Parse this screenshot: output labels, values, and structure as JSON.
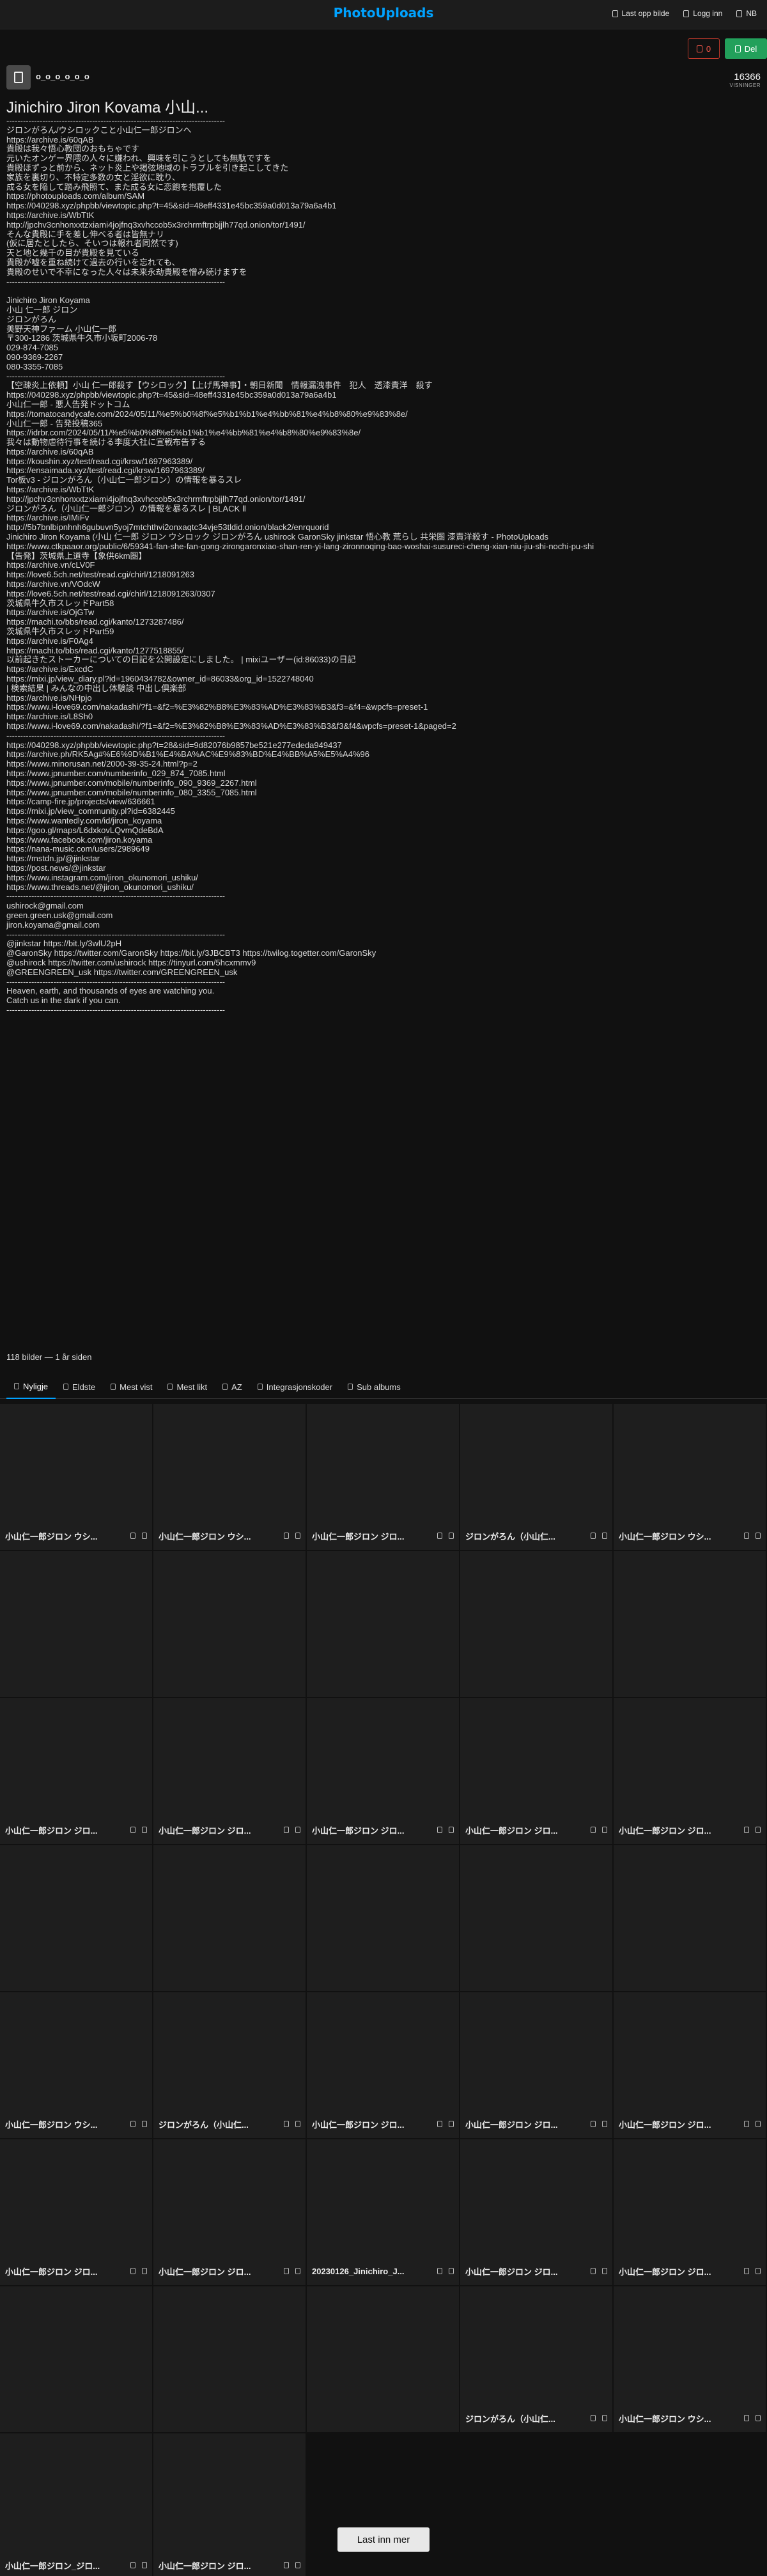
{
  "app": {
    "logo": "PhotoUploads"
  },
  "nav": {
    "upload": "Last opp bilde",
    "login": "Logg inn",
    "lang": "NB"
  },
  "header": {
    "username": "o_o_o_o_o_o",
    "counter": "0",
    "share": "Del",
    "views": "16366",
    "views_label": "VISNINGER"
  },
  "album": {
    "title": "Jinichiro Jiron Kovama 小山..."
  },
  "description": [
    "-------------------------------------------------------------------------------",
    "ジロンがろん/ウシロックこと小山仁一郎ジロンへ",
    "https://archive.is/60qAB",
    "貴殿は我々悟心教団のおもちゃです",
    "元いたオンゲー界隈の人々に嫌われ、興味を引こうとしても無駄ですを",
    "貴殿ほずっと前から、ネット炎上や掲弦地域のトラブルを引き起こしてきた",
    "家族を裏切り、不特定多数の女と淫欲に耽り、",
    "成る女を陥して踏み飛照て、また成る女に恋飽を抱覆した",
    "https://photouploads.com/album/SAM",
    "https://040298.xyz/phpbb/viewtopic.php?t=45&sid=48eff4331e45bc359a0d013a79a6a4b1",
    "https://archive.is/WbTtK",
    "http://jpchv3cnhonxxtzxiami4jojfnq3xvhccob5x3rchrmftrpbjjlh77qd.onion/tor/1491/",
    "そんな貴殿に手を差し伸べる者は皆無ナリ",
    "(仮に居たとしたら、そいつは報れ者同然です)",
    "天と地と幾千の目が貴殿を見ている",
    "貴殿が嘘を重ね続けて過去の行いを忘れても、",
    "貴殿のせいで不幸になった人々は未来永劫貴殿を憎み続けますを",
    "-------------------------------------------------------------------------------",
    "",
    "Jinichiro Jiron Koyama",
    "小山 仁一郎 ジロン",
    "ジロンがろん",
    "美野天神ファーム 小山仁一郎",
    "〒300-1286 茨城県牛久市小坂町2006-78",
    "029-874-7085",
    "090-9369-2267",
    "080-3355-7085",
    "-------------------------------------------------------------------------------",
    "【空疎炎上依頼】小山 仁一郎殺す【ウシロック】【上げ馬神事】・朝日新聞　情報漏洩事件　犯人　透漆責洋　殺す",
    "https://040298.xyz/phpbb/viewtopic.php?t=45&sid=48eff4331e45bc359a0d013a79a6a4b1",
    "小山仁一郎 - 悪人告発ドットコム",
    "https://tomatocandycafe.com/2024/05/11/%e5%b0%8f%e5%b1%b1%e4%bb%81%e4%b8%80%e9%83%8e/",
    "小山仁一郎 - 告発投稿365",
    "https://idrbr.com/2024/05/11/%e5%b0%8f%e5%b1%b1%e4%bb%81%e4%b8%80%e9%83%8e/",
    "我々は動物虐待行事を続ける李度大社に宣戦布告する",
    "https://archive.is/60qAB",
    "https://koushin.xyz/test/read.cgi/krsw/1697963389/",
    "https://ensaimada.xyz/test/read.cgi/krsw/1697963389/",
    "Tor板v3 - ジロンがろん（小山仁一郎ジロン）の情報を暴るスレ",
    "https://archive.is/WbTtK",
    "http://jpchv3cnhonxxtzxiami4jojfnq3xvhccob5x3rchrmftrpbjjlh77qd.onion/tor/1491/",
    "ジロンがろん（小山仁一郎ジロン）の情報を暴るスレ | BLACK Ⅱ",
    "https://archive.is/IMiFv",
    "http://5b7bnlbipnhnh6gubuvn5yoj7mtchthvi2onxaqtc34vje53tldid.onion/black2/enrquorid",
    "Jinichiro Jiron Koyama (小山 仁一郎 ジロン ウシロック ジロンがろん ushirock GaronSky jinkstar 悟心教 荒らし 共栄圏 漆責洋殺す - PhotoUploads",
    "https://www.ctkpaaor.org/public/6/59341-fan-she-fan-gong-zirongaronxiao-shan-ren-yi-lang-zironnoqing-bao-woshai-susureci-cheng-xian-niu-jiu-shi-nochi-pu-shi",
    "【告発】茨城県上道寺【象供6km圏】",
    "https://archive.vn/cLV0F",
    "https://love6.5ch.net/test/read.cgi/chirl/1218091263",
    "https://archive.vn/VOdcW",
    "https://love6.5ch.net/test/read.cgi/chirl/1218091263/0307",
    "茨城県牛久市スレッドPart58",
    "https://archive.is/OjGTw",
    "https://machi.to/bbs/read.cgi/kanto/1273287486/",
    "茨城県牛久市スレッドPart59",
    "https://archive.is/F0Ag4",
    "https://machi.to/bbs/read.cgi/kanto/1277518855/",
    "以前起きたストーカーについての日記を公開設定にしました。 | mixiユーザー(id:86033)の日記",
    "https://archive.is/ExcdC",
    "https://mixi.jp/view_diary.pl?id=1960434782&owner_id=86033&org_id=1522748040",
    "| 検索結果 | みんなの中出し体験談 中出し倶楽部",
    "https://archive.is/NHpjo",
    "https://www.i-love69.com/nakadashi/?f1=&f2=%E3%82%B8%E3%83%AD%E3%83%B3&f3=&f4=&wpcfs=preset-1",
    "https://archive.is/L8Sh0",
    "https://www.i-love69.com/nakadashi/?f1=&f2=%E3%82%B8%E3%83%AD%E3%83%B3&f3&f4&wpcfs=preset-1&paged=2",
    "-------------------------------------------------------------------------------",
    "https://040298.xyz/phpbb/viewtopic.php?t=28&sid=9d82076b9857be521e277ededa949437",
    "https://archive.ph/RK5Ag#%E6%9D%B1%E4%BA%AC%E9%83%BD%E4%BB%A5%E5%A4%96",
    "https://www.minorusan.net/2000-39-35-24.html?p=2",
    "https://www.jpnumber.com/numberinfo_029_874_7085.html",
    "https://www.jpnumber.com/mobile/numberinfo_090_9369_2267.html",
    "https://www.jpnumber.com/mobile/numberinfo_080_3355_7085.html",
    "https://camp-fire.jp/projects/view/636661",
    "https://mixi.jp/view_community.pl?id=6382445",
    "https://www.wantedly.com/id/jiron_koyama",
    "https://goo.gl/maps/L6dxkovLQvmQdeBdA",
    "https://www.facebook.com/jiron.koyama",
    "https://nana-music.com/users/2989649",
    "https://mstdn.jp/@jinkstar",
    "https://post.news/@jinkstar",
    "https://www.instagram.com/jiron_okunomori_ushiku/",
    "https://www.threads.net/@jiron_okunomori_ushiku/",
    "-------------------------------------------------------------------------------",
    "ushirock@gmail.com",
    "green.green.usk@gmail.com",
    "jiron.koyama@gmail.com",
    "-------------------------------------------------------------------------------",
    "@jinkstar https://bit.ly/3wlU2pH",
    "@GaronSky https://twitter.com/GaronSky https://bit.ly/3JBCBT3 https://twilog.togetter.com/GaronSky",
    "@ushirock https://twitter.com/ushirock https://tinyurl.com/5hcxmmv9",
    "@GREENGREEN_usk https://twitter.com/GREENGREEN_usk",
    "-------------------------------------------------------------------------------",
    "Heaven, earth, and thousands of eyes are watching you.",
    "Catch us in the dark if you can.",
    "-------------------------------------------------------------------------------"
  ],
  "album_meta": {
    "count_text": "118 bilder — 1 år siden"
  },
  "tabs": [
    {
      "label": "Nyligje",
      "active": true
    },
    {
      "label": "Eldste",
      "active": false
    },
    {
      "label": "Mest vist",
      "active": false
    },
    {
      "label": "Mest likt",
      "active": false
    },
    {
      "label": "AZ",
      "active": false
    },
    {
      "label": "Integrasjonskoder",
      "active": false
    },
    {
      "label": "Sub albums",
      "active": false
    }
  ],
  "tiles": [
    "小山仁一郎ジロン ウシ...",
    "小山仁一郎ジロン ウシ...",
    "小山仁一郎ジロン ジロ...",
    "ジロンがろん（小山仁...",
    "小山仁一郎ジロン ウシ...",
    "",
    "",
    "",
    "",
    "",
    "小山仁一郎ジロン ジロ...",
    "小山仁一郎ジロン ジロ...",
    "小山仁一郎ジロン ジロ...",
    "小山仁一郎ジロン ジロ...",
    "小山仁一郎ジロン ジロ...",
    "",
    "",
    "",
    "",
    "",
    "小山仁一郎ジロン ウシ...",
    "ジロンがろん（小山仁...",
    "小山仁一郎ジロン ジロ...",
    "小山仁一郎ジロン ジロ...",
    "小山仁一郎ジロン ジロ...",
    "小山仁一郎ジロン ジロ...",
    "小山仁一郎ジロン ジロ...",
    "20230126_Jinichiro_J...",
    "小山仁一郎ジロン ジロ...",
    "小山仁一郎ジロン ジロ...",
    "",
    "",
    "",
    "ジロンがろん（小山仁...",
    "小山仁一郎ジロン ウシ...",
    "小山仁一郎ジロン_ジロ...",
    "小山仁一郎ジロン ジロ..."
  ],
  "load_more": "Last inn mer",
  "colors": {
    "accent": "#00a2ff",
    "share": "#22a05b",
    "counter": "#c0392b",
    "bg": "#111111"
  }
}
